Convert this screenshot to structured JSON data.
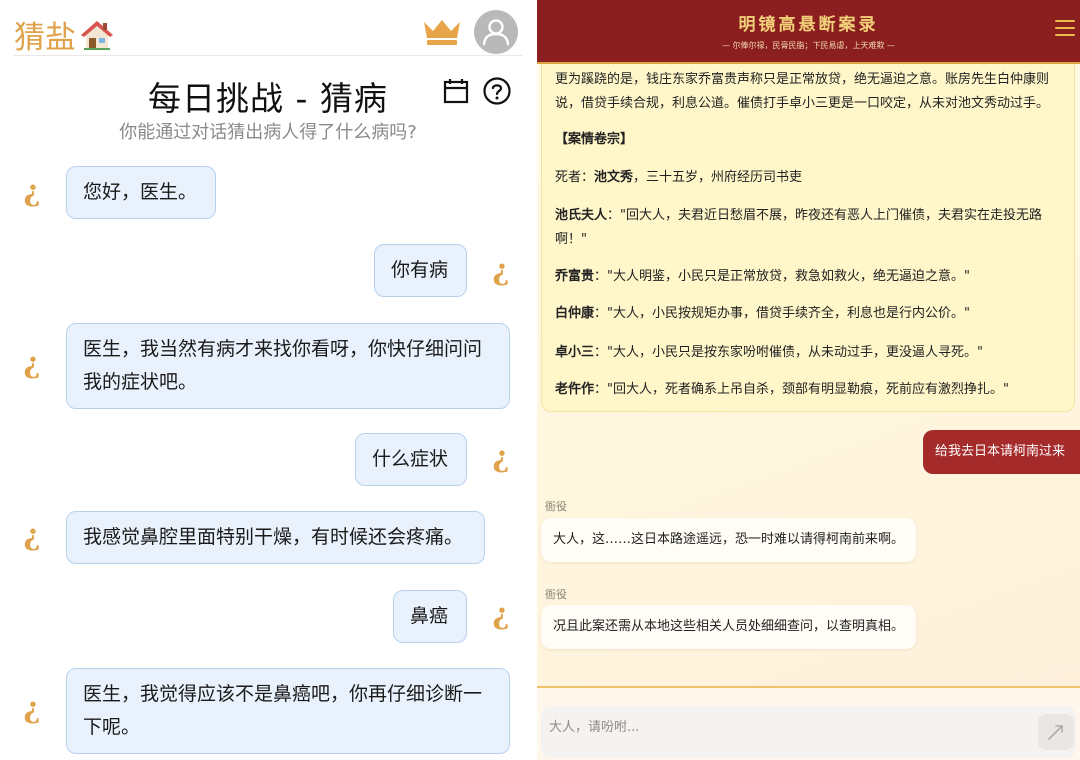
{
  "left": {
    "brand": "猜盐",
    "title": "每日挑战 - 猜病",
    "subtitle": "你能通过对话猜出病人得了什么病吗?",
    "messages": [
      {
        "role": "patient",
        "text": "您好，医生。"
      },
      {
        "role": "user",
        "text": "你有病"
      },
      {
        "role": "patient",
        "text": "医生，我当然有病才来找你看呀，你快仔细问问我的症状吧。"
      },
      {
        "role": "user",
        "text": "什么症状"
      },
      {
        "role": "patient",
        "text": "我感觉鼻腔里面特别干燥，有时候还会疼痛。"
      },
      {
        "role": "user",
        "text": "鼻癌"
      },
      {
        "role": "patient",
        "text": "医生，我觉得应该不是鼻癌吧，你再仔细诊断一下呢。"
      }
    ],
    "accent_color": "#e0a24a",
    "bubble_color": "#e9f2fc",
    "icons": [
      "house-icon",
      "crown-icon",
      "avatar-icon",
      "calendar-icon",
      "help-icon",
      "question-mark-icon"
    ]
  },
  "right": {
    "title": "明镜高悬断案录",
    "subtitle": "— 尔俸尔禄，民膏民脂；下民易虐，上天难欺 —",
    "case": {
      "intro": "更为蹊跷的是，钱庄东家乔富贵声称只是正常放贷，绝无逼迫之意。账房先生白仲康则说，借贷手续合规，利息公道。催债打手卓小三更是一口咬定，从未对池文秀动过手。",
      "section_heading": "【案情卷宗】",
      "deceased_label": "死者：",
      "deceased_name": "池文秀",
      "deceased_desc": "，三十五岁，州府经历司书吏",
      "statements": [
        {
          "name": "池氏夫人",
          "text": "：\"回大人，夫君近日愁眉不展，昨夜还有恶人上门催债，夫君实在走投无路啊！\""
        },
        {
          "name": "乔富贵",
          "text": "：\"大人明鉴，小民只是正常放贷，救急如救火，绝无逼迫之意。\""
        },
        {
          "name": "白仲康",
          "text": "：\"大人，小民按规矩办事，借贷手续齐全，利息也是行内公价。\""
        },
        {
          "name": "卓小三",
          "text": "：\"大人，小民只是按东家吩咐催债，从未动过手，更没逼人寻死。\""
        },
        {
          "name": "老仵作",
          "text": "：\"回大人，死者确系上吊自杀，颈部有明显勒痕，死前应有激烈挣扎。\""
        }
      ]
    },
    "user_message": "给我去日本请柯南过来",
    "npc_messages": [
      {
        "speaker": "衙役",
        "text": "大人，这……这日本路途遥远，恐一时难以请得柯南前来啊。"
      },
      {
        "speaker": "衙役",
        "text": "况且此案还需从本地这些相关人员处细细查问，以查明真相。"
      }
    ],
    "input_placeholder": "大人，请吩咐...",
    "header_color": "#8b1e1e",
    "accent_gold": "#d9a640",
    "icons": [
      "menu-icon",
      "send-icon"
    ]
  }
}
